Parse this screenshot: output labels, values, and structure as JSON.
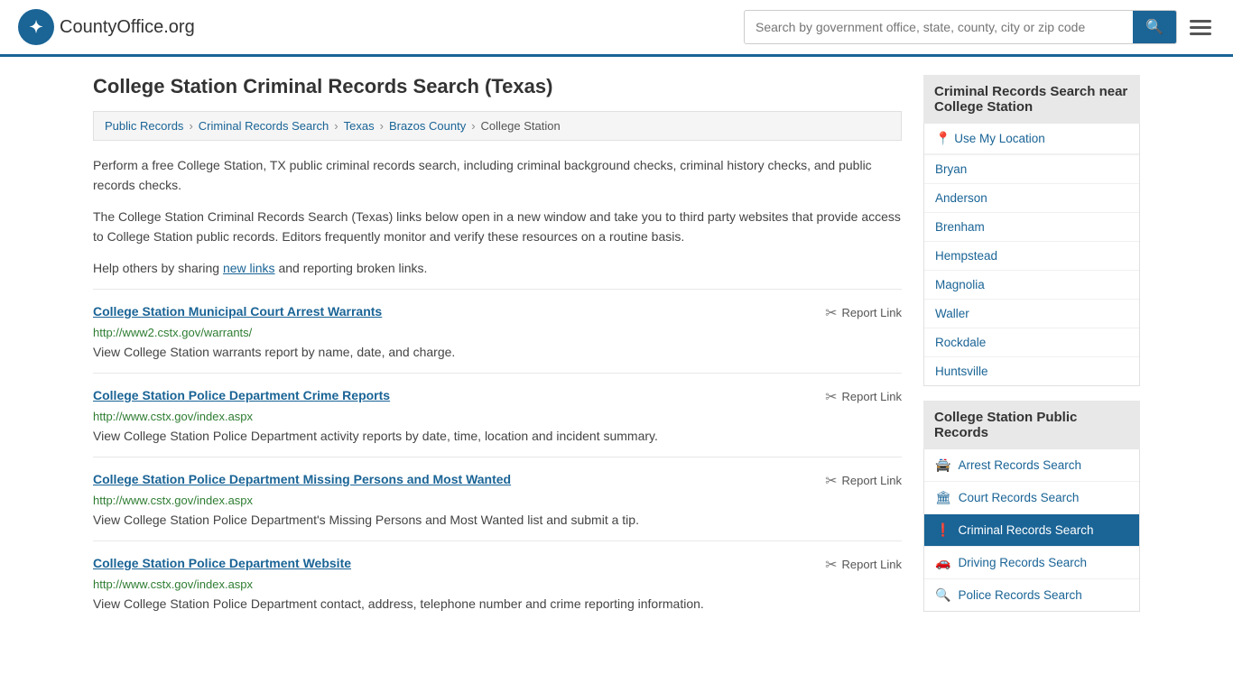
{
  "header": {
    "logo_text": "CountyOffice",
    "logo_suffix": ".org",
    "search_placeholder": "Search by government office, state, county, city or zip code",
    "search_button_label": "Search"
  },
  "page": {
    "title": "College Station Criminal Records Search (Texas)",
    "breadcrumb": [
      {
        "label": "Public Records",
        "href": "#"
      },
      {
        "label": "Criminal Records Search",
        "href": "#"
      },
      {
        "label": "Texas",
        "href": "#"
      },
      {
        "label": "Brazos County",
        "href": "#"
      },
      {
        "label": "College Station",
        "href": "#"
      }
    ],
    "description1": "Perform a free College Station, TX public criminal records search, including criminal background checks, criminal history checks, and public records checks.",
    "description2": "The College Station Criminal Records Search (Texas) links below open in a new window and take you to third party websites that provide access to College Station public records. Editors frequently monitor and verify these resources on a routine basis.",
    "description3_prefix": "Help others by sharing ",
    "description3_link": "new links",
    "description3_suffix": " and reporting broken links.",
    "resources": [
      {
        "title": "College Station Municipal Court Arrest Warrants",
        "url": "http://www2.cstx.gov/warrants/",
        "description": "View College Station warrants report by name, date, and charge.",
        "report_label": "Report Link"
      },
      {
        "title": "College Station Police Department Crime Reports",
        "url": "http://www.cstx.gov/index.aspx",
        "description": "View College Station Police Department activity reports by date, time, location and incident summary.",
        "report_label": "Report Link"
      },
      {
        "title": "College Station Police Department Missing Persons and Most Wanted",
        "url": "http://www.cstx.gov/index.aspx",
        "description": "View College Station Police Department's Missing Persons and Most Wanted list and submit a tip.",
        "report_label": "Report Link"
      },
      {
        "title": "College Station Police Department Website",
        "url": "http://www.cstx.gov/index.aspx",
        "description": "View College Station Police Department contact, address, telephone number and crime reporting information.",
        "report_label": "Report Link"
      }
    ]
  },
  "sidebar": {
    "nearby_heading": "Criminal Records Search near College Station",
    "use_my_location": "Use My Location",
    "nearby_cities": [
      "Bryan",
      "Anderson",
      "Brenham",
      "Hempstead",
      "Magnolia",
      "Waller",
      "Rockdale",
      "Huntsville"
    ],
    "public_records_heading": "College Station Public Records",
    "public_records_items": [
      {
        "label": "Arrest Records Search",
        "icon": "🚔",
        "active": false
      },
      {
        "label": "Court Records Search",
        "icon": "🏛",
        "active": false
      },
      {
        "label": "Criminal Records Search",
        "icon": "❗",
        "active": true
      },
      {
        "label": "Driving Records Search",
        "icon": "🚗",
        "active": false
      },
      {
        "label": "Police Records Search",
        "icon": "🔍",
        "active": false
      }
    ]
  }
}
